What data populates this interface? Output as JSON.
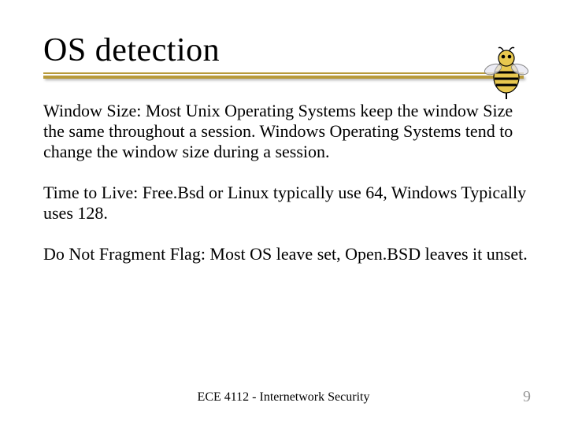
{
  "slide": {
    "title": "OS detection",
    "paragraphs": [
      "Window Size: Most Unix Operating Systems keep the window Size the same throughout a session. Windows Operating Systems tend to change the window size during a session.",
      "Time to Live: Free.Bsd or Linux typically use 64, Windows Typically uses 128.",
      "Do Not Fragment Flag: Most OS leave set, Open.BSD leaves it unset."
    ],
    "footer": "ECE 4112 - Internetwork Security",
    "page_number": "9"
  },
  "icons": {
    "mascot": "buzz-mascot"
  },
  "colors": {
    "accent": "#b89a3a"
  }
}
